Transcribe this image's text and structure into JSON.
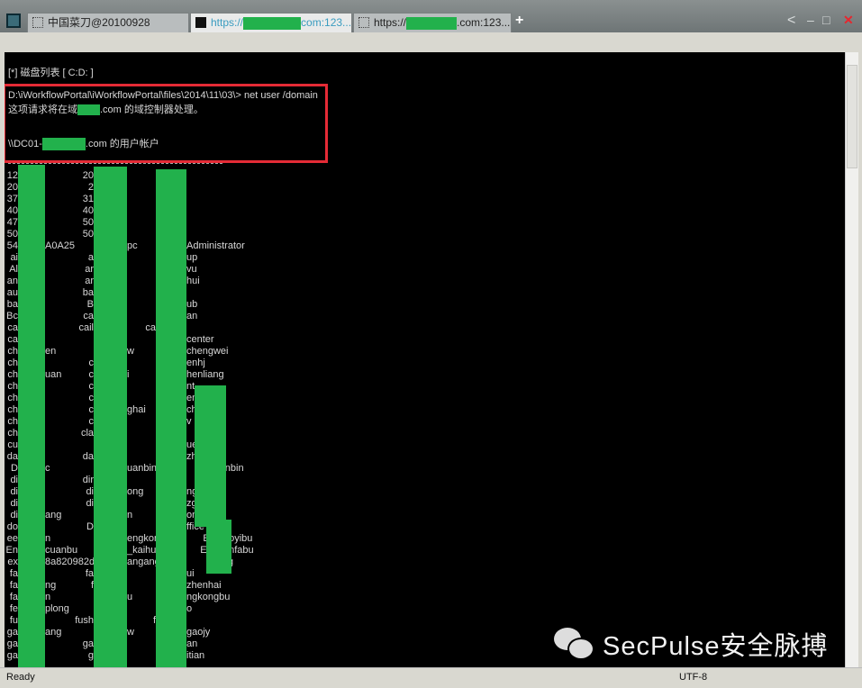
{
  "tabs": [
    {
      "label": "中国菜刀@20100928",
      "state": "inactive"
    },
    {
      "label_prefix": "https://",
      "label_suffix": "com:123...",
      "state": "active"
    },
    {
      "label_prefix": "https://",
      "label_suffix": ".com:123...",
      "state": "inactive"
    }
  ],
  "new_tab": "+",
  "window_controls": {
    "back": "<",
    "minimize": "–",
    "maximize": "□",
    "close": "✕"
  },
  "terminal": {
    "disk_list": "[*] 磁盘列表 [ C:D: ]",
    "command": "D:\\iWorkflowPortal\\iWorkflowPortal\\files\\2014\\11\\03\\> net user /domain",
    "msg_prefix": "这项请求将在域",
    "msg_suffix": ".com 的域控制器处理。",
    "acct_prefix": "\\\\DC01-",
    "acct_suffix": ".com 的用户帐户",
    "rows": [
      [
        [
          "12",
          ""
        ],
        [
          "20",
          ""
        ],
        [
          "",
          ""
        ]
      ],
      [
        [
          "20",
          ""
        ],
        [
          "2",
          ""
        ],
        [
          "",
          ""
        ]
      ],
      [
        [
          "37",
          ""
        ],
        [
          "31",
          ""
        ],
        [
          "",
          ""
        ]
      ],
      [
        [
          "40",
          ""
        ],
        [
          "40",
          ""
        ],
        [
          "",
          ""
        ]
      ],
      [
        [
          "47",
          ""
        ],
        [
          "50",
          ""
        ],
        [
          "",
          ""
        ]
      ],
      [
        [
          "50",
          ""
        ],
        [
          "50",
          ""
        ],
        [
          "",
          ""
        ]
      ],
      [
        [
          "54",
          "A0A25"
        ],
        [
          "",
          "pc"
        ],
        [
          "",
          "Administrator"
        ]
      ],
      [
        [
          "ai",
          ""
        ],
        [
          "a",
          ""
        ],
        [
          "",
          "up"
        ]
      ],
      [
        [
          "Al",
          ""
        ],
        [
          "ar",
          ""
        ],
        [
          "",
          "vu"
        ]
      ],
      [
        [
          "an",
          ""
        ],
        [
          "ar",
          ""
        ],
        [
          "",
          "hui"
        ]
      ],
      [
        [
          "au",
          ""
        ],
        [
          "ba",
          ""
        ],
        [
          "",
          ""
        ]
      ],
      [
        [
          "ba",
          ""
        ],
        [
          "B",
          ""
        ],
        [
          "",
          "ub"
        ]
      ],
      [
        [
          "Bc",
          ""
        ],
        [
          "ca",
          ""
        ],
        [
          "",
          "an"
        ]
      ],
      [
        [
          "ca",
          ""
        ],
        [
          "cail",
          ""
        ],
        [
          "ca",
          ""
        ]
      ],
      [
        [
          "ca",
          ""
        ],
        [
          "",
          ""
        ],
        [
          "",
          "center"
        ]
      ],
      [
        [
          "ch",
          "en"
        ],
        [
          "",
          "w"
        ],
        [
          "",
          "chengwei"
        ]
      ],
      [
        [
          "ch",
          ""
        ],
        [
          "c",
          ""
        ],
        [
          "",
          "enhj"
        ]
      ],
      [
        [
          "ch",
          "uan"
        ],
        [
          "c",
          "i"
        ],
        [
          "",
          "henliang"
        ]
      ],
      [
        [
          "ch",
          ""
        ],
        [
          "c",
          ""
        ],
        [
          "",
          "nt"
        ]
      ],
      [
        [
          "ch",
          ""
        ],
        [
          "c",
          ""
        ],
        [
          "",
          "en"
        ]
      ],
      [
        [
          "ch",
          ""
        ],
        [
          "c",
          "ghai"
        ],
        [
          "",
          "ch      xia"
        ]
      ],
      [
        [
          "ch",
          ""
        ],
        [
          "c",
          ""
        ],
        [
          "",
          "v"
        ]
      ],
      [
        [
          "ch",
          ""
        ],
        [
          "cla",
          ""
        ],
        [
          "",
          ""
        ]
      ],
      [
        [
          "cu",
          ""
        ],
        [
          "",
          ""
        ],
        [
          "",
          "ue"
        ]
      ],
      [
        [
          "da",
          ""
        ],
        [
          "da",
          ""
        ],
        [
          "",
          "zh"
        ]
      ],
      [
        [
          "D",
          "c"
        ],
        [
          "",
          "uanbin"
        ],
        [
          "",
          "   d       anbin"
        ]
      ],
      [
        [
          "di",
          ""
        ],
        [
          "dir",
          ""
        ],
        [
          "",
          ""
        ]
      ],
      [
        [
          "di",
          ""
        ],
        [
          "di",
          "ong"
        ],
        [
          "",
          "ng"
        ]
      ],
      [
        [
          "di",
          ""
        ],
        [
          "di",
          ""
        ],
        [
          "",
          "zg"
        ]
      ],
      [
        [
          "di",
          "ang"
        ],
        [
          "",
          "n"
        ],
        [
          "",
          "on"
        ]
      ],
      [
        [
          "do",
          ""
        ],
        [
          "D",
          ""
        ],
        [
          "",
          "ffice"
        ]
      ],
      [
        [
          "ee",
          "n"
        ],
        [
          "",
          "engkon"
        ],
        [
          "",
          "      E     aoyibu"
        ]
      ],
      [
        [
          "En",
          "cuanbu"
        ],
        [
          "",
          "_kaihu"
        ],
        [
          "",
          "     En      nfabu"
        ]
      ],
      [
        [
          "ex",
          "8a820982d"
        ],
        [
          "",
          "angang"
        ],
        [
          "",
          "             ng"
        ]
      ],
      [
        [
          "fa",
          ""
        ],
        [
          "fa",
          ""
        ],
        [
          "",
          "ui"
        ]
      ],
      [
        [
          "fa",
          "ng"
        ],
        [
          "f",
          ""
        ],
        [
          "",
          "zhenhai"
        ]
      ],
      [
        [
          "fa",
          "n"
        ],
        [
          "",
          "u"
        ],
        [
          "",
          "ngkongbu"
        ]
      ],
      [
        [
          "fe",
          "plong"
        ],
        [
          "",
          ""
        ],
        [
          "",
          "o"
        ]
      ],
      [
        [
          "fu",
          ""
        ],
        [
          "fush",
          ""
        ],
        [
          "f",
          ""
        ]
      ],
      [
        [
          "ga",
          "ang"
        ],
        [
          "",
          "w"
        ],
        [
          "",
          "gaojy"
        ]
      ],
      [
        [
          "ga",
          ""
        ],
        [
          "ga",
          ""
        ],
        [
          "",
          "an"
        ]
      ],
      [
        [
          "ga",
          ""
        ],
        [
          "g",
          ""
        ],
        [
          "",
          "itian"
        ]
      ]
    ]
  },
  "watermark": "SecPulse安全脉搏",
  "status": {
    "left": "Ready",
    "encoding": "UTF-8"
  },
  "colors": {
    "redaction": "#22b14c",
    "highlight_box": "#e52b36",
    "terminal_bg": "#000000"
  }
}
